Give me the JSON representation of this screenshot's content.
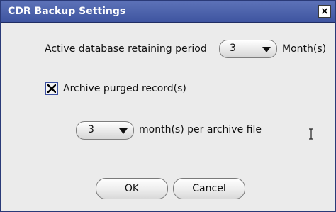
{
  "window": {
    "title": "CDR Backup Settings",
    "close_label": "×"
  },
  "retention": {
    "label": "Active database retaining period",
    "value": "3",
    "unit": "Month(s)"
  },
  "archive": {
    "checkbox_label": "Archive purged record(s)",
    "checked": true,
    "months_value": "3",
    "months_label": "month(s) per archive file"
  },
  "buttons": {
    "ok": "OK",
    "cancel": "Cancel"
  },
  "icons": {
    "check": "check-icon",
    "dropdown": "chevron-down-icon",
    "cursor": "text-cursor-icon"
  }
}
